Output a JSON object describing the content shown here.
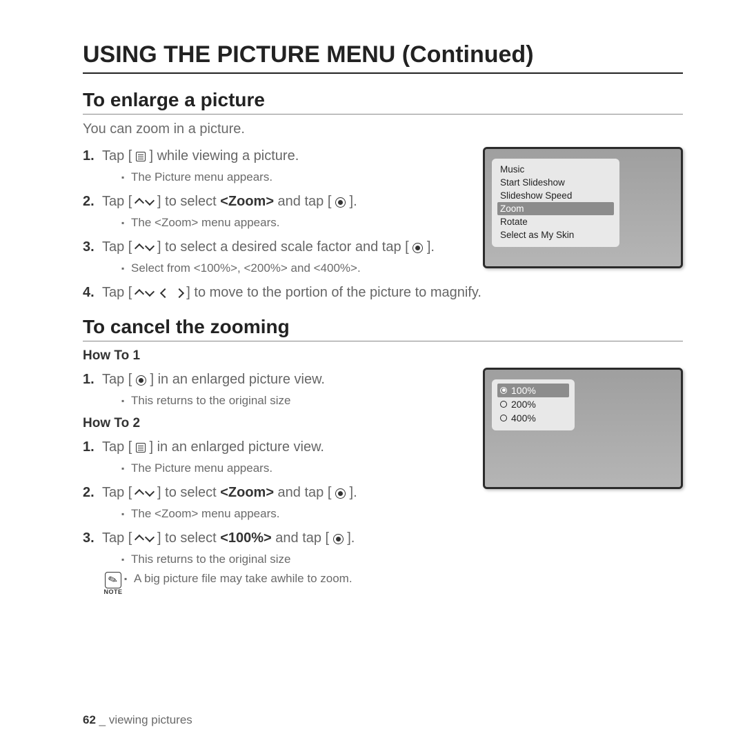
{
  "title": "USING THE PICTURE MENU (Continued)",
  "section1": {
    "heading": "To enlarge a picture",
    "intro": "You can zoom in a picture.",
    "step1_a": "Tap [",
    "step1_b": "] while viewing a picture.",
    "step1_sub": "The Picture menu appears.",
    "step2_a": "Tap [",
    "step2_b": "] to select ",
    "step2_bold": "<Zoom>",
    "step2_c": " and tap [",
    "step2_d": "].",
    "step2_sub": "The <Zoom> menu appears.",
    "step3_a": "Tap [",
    "step3_b": "] to select a desired scale factor and tap [",
    "step3_c": "].",
    "step3_sub": "Select from <100%>, <200%> and <400%>.",
    "step4_a": "Tap [",
    "step4_b": "] to move to the portion of the picture to magnify."
  },
  "menu1": {
    "items": [
      "Music",
      "Start Slideshow",
      "Slideshow Speed",
      "Zoom",
      "Rotate",
      "Select as My Skin"
    ],
    "selected": "Zoom"
  },
  "section2": {
    "heading": "To cancel the zooming",
    "howto1": "How To 1",
    "h1_step1_a": "Tap [",
    "h1_step1_b": "] in an enlarged picture view.",
    "h1_step1_sub": "This returns to the original size",
    "howto2": "How To 2",
    "h2_step1_a": "Tap [",
    "h2_step1_b": "] in an enlarged picture view.",
    "h2_step1_sub": "The Picture menu appears.",
    "h2_step2_a": "Tap [",
    "h2_step2_b": "] to select ",
    "h2_step2_bold": "<Zoom>",
    "h2_step2_c": " and tap [",
    "h2_step2_d": "].",
    "h2_step2_sub": "The <Zoom> menu appears.",
    "h2_step3_a": "Tap [",
    "h2_step3_b": "] to select ",
    "h2_step3_bold": "<100%>",
    "h2_step3_c": " and tap [",
    "h2_step3_d": "].",
    "h2_step3_sub": "This returns to the original size"
  },
  "menu2": {
    "items": [
      "100%",
      "200%",
      "400%"
    ],
    "selected": "100%"
  },
  "note": {
    "label": "NOTE",
    "text": "A big picture file may take awhile to zoom."
  },
  "footer": {
    "page": "62",
    "sep": " _ ",
    "section": "viewing pictures"
  }
}
